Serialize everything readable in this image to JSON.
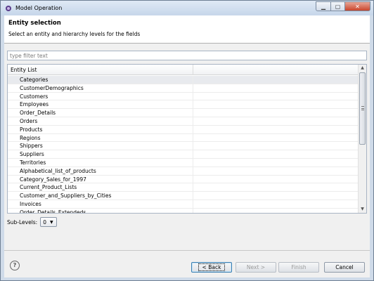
{
  "window": {
    "title": "Model Operation",
    "icon": "model-operation-icon"
  },
  "header": {
    "title": "Entity selection",
    "subtitle": "Select an entity and hierarchy levels for the fields"
  },
  "filter": {
    "placeholder": "type filter text",
    "value": ""
  },
  "table": {
    "columns": [
      "Entity List",
      ""
    ],
    "rows": [
      "Categories",
      "CustomerDemographics",
      "Customers",
      "Employees",
      "Order_Details",
      "Orders",
      "Products",
      "Regions",
      "Shippers",
      "Suppliers",
      "Territories",
      "Alphabetical_list_of_products",
      "Category_Sales_for_1997",
      "Current_Product_Lists",
      "Customer_and_Suppliers_by_Cities",
      "Invoices",
      "Order_Details_Extendeds"
    ],
    "selected_index": 0
  },
  "sublevels": {
    "label": "Sub-Levels:",
    "value": "0"
  },
  "footer": {
    "back_label": "< Back",
    "next_label": "Next >",
    "finish_label": "Finish",
    "cancel_label": "Cancel"
  }
}
